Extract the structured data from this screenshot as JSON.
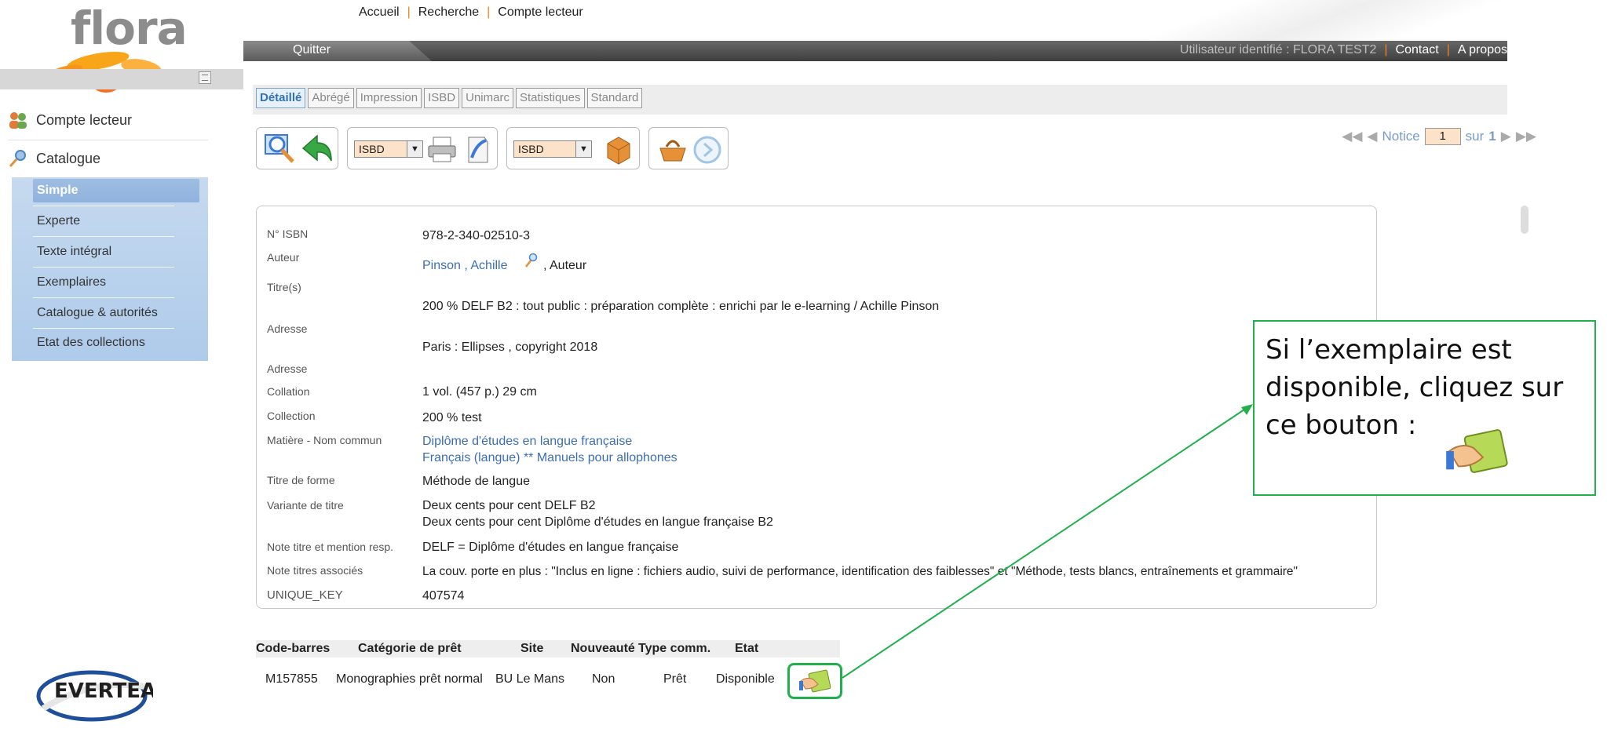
{
  "brand": {
    "app_name": "flora",
    "vendor_logo": "EVERTEAM"
  },
  "topnav": {
    "items": [
      "Accueil",
      "Recherche",
      "Compte lecteur"
    ]
  },
  "topbar": {
    "quit": "Quitter",
    "user": "Utilisateur identifié : FLORA TEST2",
    "contact": "Contact",
    "about": "A propos"
  },
  "sidebar": {
    "account": "Compte lecteur",
    "catalogue": "Catalogue",
    "sub": [
      "Simple",
      "Experte",
      "Texte intégral",
      "Exemplaires",
      "Catalogue & autorités",
      "Etat des collections"
    ]
  },
  "tabs": [
    "Détaillé",
    "Abrégé",
    "Impression",
    "ISBD",
    "Unimarc",
    "Statistiques",
    "Standard"
  ],
  "toolbar": {
    "print_format": "ISBD",
    "export_format": "ISBD"
  },
  "pager": {
    "label": "Notice",
    "current": "1",
    "total_label": "sur",
    "total": "1"
  },
  "record": {
    "isbn_label": "N° ISBN",
    "isbn": "978-2-340-02510-3",
    "author_label": "Auteur",
    "author": "Pinson , Achille",
    "author_role": ",  Auteur",
    "title_label": "Titre(s)",
    "title": "200 % DELF B2 : tout public : préparation complète : enrichi par le e-learning  / Achille Pinson",
    "address_label": "Adresse",
    "address": "Paris : Ellipses , copyright 2018",
    "address2_label": "Adresse",
    "collation_label": "Collation",
    "collation": "1 vol. (457 p.) 29 cm",
    "collection_label": "Collection",
    "collection": "200 % test",
    "subject_label": "Matière - Nom commun",
    "subject_1": "Diplôme d'études en langue française",
    "subject_2": "Français (langue) ** Manuels pour allophones",
    "form_label": "Titre de forme",
    "form": "Méthode de langue",
    "variant_label": "Variante de titre",
    "variant_1": "Deux cents pour cent DELF B2",
    "variant_2": "Deux cents pour cent Diplôme d'études en langue française B2",
    "note_resp_label": "Note titre et mention resp.",
    "note_resp": "DELF = Diplôme d'études en langue française",
    "note_assoc_label": "Note titres associés",
    "note_assoc": "La couv. porte en plus : \"Inclus en ligne : fichiers audio, suivi de performance, identification des faiblesses\" et \"Méthode, tests blancs, entraînements et grammaire\"",
    "key_label": "UNIQUE_KEY",
    "key": "407574"
  },
  "items": {
    "headers": [
      "Code-barres",
      "Catégorie de prêt",
      "Site",
      "Nouveauté",
      "Type comm.",
      "Etat"
    ],
    "row": {
      "barcode": "M157855",
      "category": "Monographies prêt normal",
      "site": "BU Le Mans",
      "new": "Non",
      "type": "Prêt",
      "state": "Disponible"
    }
  },
  "callout": {
    "text": "Si l’exemplaire est disponible, cliquez sur ce bouton :"
  },
  "colors": {
    "accent_orange": "#f58220",
    "link_blue": "#3d6eb4",
    "callout_green": "#22b04b",
    "sidebar_blue": "#aecbea"
  }
}
